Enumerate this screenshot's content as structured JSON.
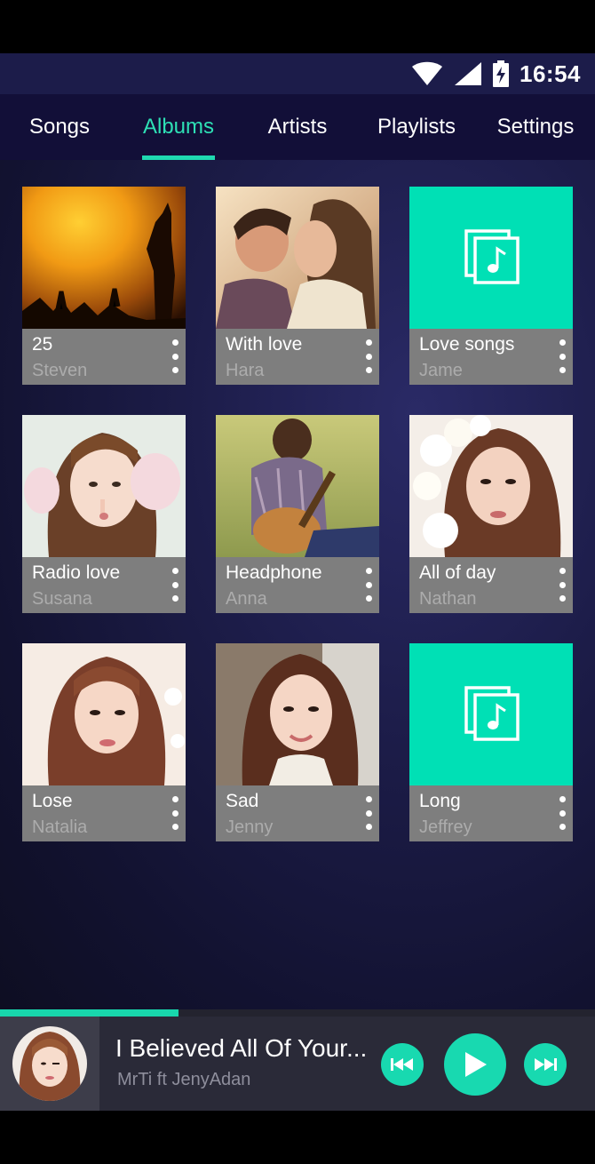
{
  "status_bar": {
    "time": "16:54",
    "icons": [
      "wifi-icon",
      "signal-icon",
      "battery-charging-icon"
    ]
  },
  "tabs": [
    {
      "label": "Songs",
      "active": false
    },
    {
      "label": "Albums",
      "active": true
    },
    {
      "label": "Artists",
      "active": false
    },
    {
      "label": "Playlists",
      "active": false
    },
    {
      "label": "Settings",
      "active": false
    }
  ],
  "albums": [
    {
      "title": "25",
      "artist": "Steven",
      "art": "concert-photo"
    },
    {
      "title": "With love",
      "artist": "Hara",
      "art": "couple-kiss-photo"
    },
    {
      "title": "Love songs",
      "artist": "Jame",
      "art": "music-note-placeholder-icon"
    },
    {
      "title": "Radio love",
      "artist": "Susana",
      "art": "girl-earmuffs-photo"
    },
    {
      "title": "Headphone",
      "artist": "Anna",
      "art": "guitar-man-photo"
    },
    {
      "title": "All of day",
      "artist": "Nathan",
      "art": "girl-flowers-photo"
    },
    {
      "title": "Lose",
      "artist": "Natalia",
      "art": "girl-portrait-photo"
    },
    {
      "title": "Sad",
      "artist": "Jenny",
      "art": "girl-smiling-photo"
    },
    {
      "title": "Long",
      "artist": "Jeffrey",
      "art": "music-note-placeholder-icon"
    }
  ],
  "now_playing": {
    "title": "I Believed All Of Your...",
    "artist": "MrTi ft JenyAdan",
    "progress": 0.3
  },
  "colors": {
    "accent": "#18d9b0",
    "tab_bar": "#120f38",
    "status_bar": "#1c1c4a",
    "card_info": "#7e7e7e"
  }
}
